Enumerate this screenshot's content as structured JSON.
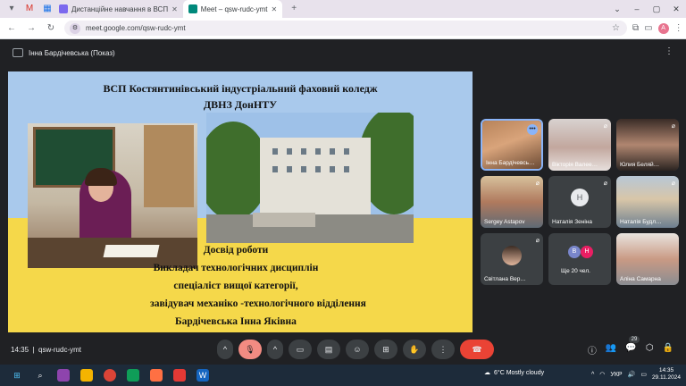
{
  "browser": {
    "tabs": [
      {
        "label": "Дистанційне навчання в ВСП",
        "active": false
      },
      {
        "label": "Meet – qsw-rudc-ymt",
        "active": true
      }
    ],
    "url": "meet.google.com/qsw-rudc-ymt",
    "profile_initial": "A"
  },
  "meet": {
    "presenter_label": "Інна Бардічевська (Показ)",
    "slide": {
      "title_line1": "ВСП Костянтинівський індустріальний фаховий коледж",
      "title_line2": "ДВНЗ ДонНТУ",
      "lines": [
        "Досвід роботи",
        "Викладач технологічних дисциплін",
        "спеціаліст вищої категорії,",
        "завідувач механіко -технологічного відділення",
        "Бардічевська Інна Яківна"
      ]
    },
    "participants": [
      {
        "name": "Інна Бардічевсь…",
        "initial": ""
      },
      {
        "name": "Вікторія Валее…",
        "initial": ""
      },
      {
        "name": "Юлия Беляй…",
        "initial": ""
      },
      {
        "name": "Sergey Astapov",
        "initial": ""
      },
      {
        "name": "Наталія Зеніна",
        "initial": "Н"
      },
      {
        "name": "Наталія Будл…",
        "initial": ""
      },
      {
        "name": "Світлана Вер…",
        "initial": ""
      },
      {
        "name": "Ще 20 чел.",
        "initial": ""
      },
      {
        "name": "Аліна Самарна",
        "initial": ""
      }
    ],
    "more_initials": [
      "B",
      "H"
    ],
    "time": "14:35",
    "meeting_code": "qsw-rudc-ymt",
    "participant_count": "29"
  },
  "taskbar": {
    "weather": "6°C  Mostly cloudy",
    "lang": "УКР",
    "time": "14:35",
    "date": "29.11.2024"
  },
  "colors": {
    "slide_sky": "#a9c9ec",
    "slide_yellow": "#f5d84a",
    "meet_bg": "#202124",
    "end_call": "#ea4335"
  }
}
